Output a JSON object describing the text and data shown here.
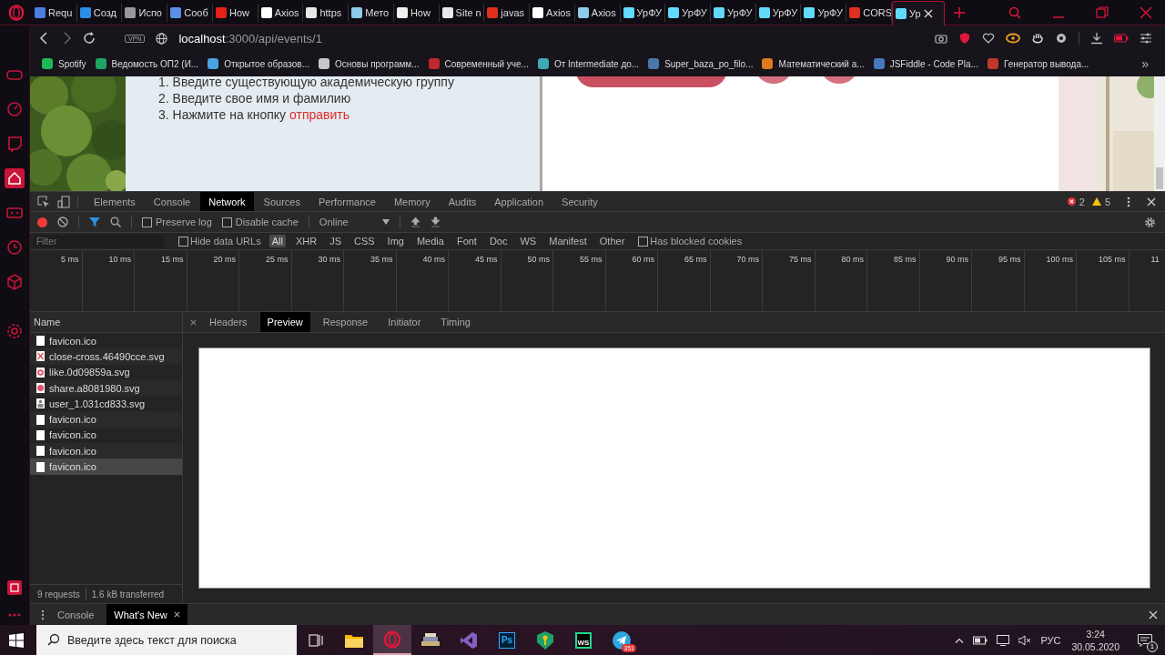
{
  "browser": {
    "tabs": [
      {
        "label": "Requ",
        "color": "#4a7fe0",
        "selected": false
      },
      {
        "label": "Созд",
        "color": "#2a8fe8",
        "selected": false
      },
      {
        "label": "Испо",
        "color": "#9a9a9a",
        "selected": false
      },
      {
        "label": "Сооб",
        "color": "#5b8fe6",
        "selected": false
      },
      {
        "label": "How",
        "color": "#e62117",
        "selected": false
      },
      {
        "label": "Axios",
        "color": "#ffffff",
        "selected": false
      },
      {
        "label": "https",
        "color": "#e8e8e8",
        "selected": false
      },
      {
        "label": "Мето",
        "color": "#8ecbe8",
        "selected": false
      },
      {
        "label": "How",
        "color": "#f0f0f0",
        "selected": false
      },
      {
        "label": "Site n",
        "color": "#e8e8e8",
        "selected": false
      },
      {
        "label": "javas",
        "color": "#e0301e",
        "selected": false
      },
      {
        "label": "Axios",
        "color": "#ffffff",
        "selected": false
      },
      {
        "label": "Axios",
        "color": "#8ecbe8",
        "selected": false
      },
      {
        "label": "УрФУ",
        "color": "#61dafb",
        "selected": false
      },
      {
        "label": "УрФУ",
        "color": "#61dafb",
        "selected": false
      },
      {
        "label": "УрФУ",
        "color": "#61dafb",
        "selected": false
      },
      {
        "label": "УрФУ",
        "color": "#61dafb",
        "selected": false
      },
      {
        "label": "УрФУ",
        "color": "#61dafb",
        "selected": false
      },
      {
        "label": "CORS",
        "color": "#e0301e",
        "selected": false
      },
      {
        "label": "Ур",
        "color": "#61dafb",
        "selected": true
      }
    ],
    "address": {
      "vpn": "VPN",
      "host": "localhost",
      "path": ":3000/api/events/1"
    },
    "bookmarks": [
      {
        "label": "Spotify",
        "color": "#1db954"
      },
      {
        "label": "Ведомость ОП2 (И...",
        "color": "#1fa463"
      },
      {
        "label": "Открытое образов...",
        "color": "#4aa3df"
      },
      {
        "label": "Основы программ...",
        "color": "#c8c8c8"
      },
      {
        "label": "Современный уче...",
        "color": "#c0282d"
      },
      {
        "label": "От Intermediate до...",
        "color": "#3fa7b5"
      },
      {
        "label": "Super_baza_po_filo...",
        "color": "#4a76a8"
      },
      {
        "label": "Математический а...",
        "color": "#e07a1f"
      },
      {
        "label": "JSFiddle - Code Pla...",
        "color": "#4679bd"
      },
      {
        "label": "Генератор вывода...",
        "color": "#c0392b"
      }
    ],
    "more": "»"
  },
  "page": {
    "steps": [
      {
        "number": "1.",
        "text": "Введите существующую академическую группу"
      },
      {
        "number": "2.",
        "text": "Введите свое имя и фамилию"
      },
      {
        "number": "3.",
        "text": "Нажмите на кнопку",
        "link": "отправить"
      }
    ]
  },
  "devtools": {
    "tabs": [
      {
        "label": "Elements",
        "selected": false
      },
      {
        "label": "Console",
        "selected": false
      },
      {
        "label": "Network",
        "selected": true
      },
      {
        "label": "Sources",
        "selected": false
      },
      {
        "label": "Performance",
        "selected": false
      },
      {
        "label": "Memory",
        "selected": false
      },
      {
        "label": "Audits",
        "selected": false
      },
      {
        "label": "Application",
        "selected": false
      },
      {
        "label": "Security",
        "selected": false
      }
    ],
    "errors": "2",
    "warnings": "5",
    "toolbar": {
      "recording": true,
      "checkboxes": [
        {
          "label": "Preserve log",
          "checked": false
        },
        {
          "label": "Disable cache",
          "checked": false
        }
      ],
      "throttle": "Online"
    },
    "filter": {
      "placeholder": "Filter",
      "hide_data_urls": {
        "label": "Hide data URLs",
        "checked": false
      },
      "types": [
        {
          "label": "All",
          "selected": true
        },
        {
          "label": "XHR",
          "selected": false
        },
        {
          "label": "JS",
          "selected": false
        },
        {
          "label": "CSS",
          "selected": false
        },
        {
          "label": "Img",
          "selected": false
        },
        {
          "label": "Media",
          "selected": false
        },
        {
          "label": "Font",
          "selected": false
        },
        {
          "label": "Doc",
          "selected": false
        },
        {
          "label": "WS",
          "selected": false
        },
        {
          "label": "Manifest",
          "selected": false
        },
        {
          "label": "Other",
          "selected": false
        }
      ],
      "blocked_cookies": {
        "label": "Has blocked cookies",
        "checked": false
      }
    },
    "timeline": {
      "ticks": [
        "5 ms",
        "10 ms",
        "15 ms",
        "20 ms",
        "25 ms",
        "30 ms",
        "35 ms",
        "40 ms",
        "45 ms",
        "50 ms",
        "55 ms",
        "60 ms",
        "65 ms",
        "70 ms",
        "75 ms",
        "80 ms",
        "85 ms",
        "90 ms",
        "95 ms",
        "100 ms",
        "105 ms",
        "11"
      ]
    },
    "requests": {
      "column": "Name",
      "rows": [
        {
          "name": "favicon.ico",
          "kind": "blank",
          "selected": false
        },
        {
          "name": "close-cross.46490cce.svg",
          "kind": "cross",
          "selected": false
        },
        {
          "name": "like.0d09859a.svg",
          "kind": "like",
          "selected": false
        },
        {
          "name": "share.a8081980.svg",
          "kind": "share",
          "selected": false
        },
        {
          "name": "user_1.031cd833.svg",
          "kind": "user",
          "selected": false
        },
        {
          "name": "favicon.ico",
          "kind": "blank",
          "selected": false
        },
        {
          "name": "favicon.ico",
          "kind": "blank",
          "selected": false
        },
        {
          "name": "favicon.ico",
          "kind": "blank",
          "selected": false
        },
        {
          "name": "favicon.ico",
          "kind": "blank",
          "selected": true
        }
      ]
    },
    "detail_tabs": [
      {
        "label": "Headers",
        "selected": false
      },
      {
        "label": "Preview",
        "selected": true
      },
      {
        "label": "Response",
        "selected": false
      },
      {
        "label": "Initiator",
        "selected": false
      },
      {
        "label": "Timing",
        "selected": false
      }
    ],
    "status": {
      "requests": "9 requests",
      "transferred": "1.6 kB transferred"
    }
  },
  "drawer": {
    "tabs": [
      {
        "label": "Console",
        "selected": false,
        "closable": false
      },
      {
        "label": "What's New",
        "selected": true,
        "closable": true
      }
    ]
  },
  "taskbar": {
    "search": {
      "placeholder": "Введите здесь текст для поиска"
    },
    "apps": [
      {
        "kind": "taskview",
        "selected": false
      },
      {
        "kind": "folder",
        "selected": false
      },
      {
        "kind": "opera",
        "selected": true
      },
      {
        "kind": "books",
        "selected": false
      },
      {
        "kind": "vs",
        "selected": false
      },
      {
        "kind": "ps",
        "label": "Ps",
        "selected": false
      },
      {
        "kind": "keepass",
        "selected": false
      },
      {
        "kind": "ws",
        "label": "WS",
        "selected": false
      },
      {
        "kind": "telegram",
        "badge": "351",
        "selected": false
      }
    ],
    "language": "РУС",
    "time": "3:24",
    "date": "30.05.2020",
    "notifications": "1"
  }
}
